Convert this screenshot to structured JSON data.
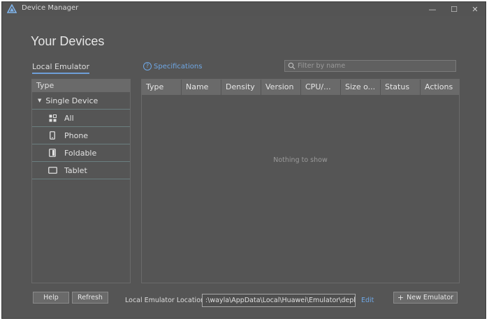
{
  "window": {
    "title": "Device Manager",
    "controls": {
      "minimize": "—",
      "maximize": "☐",
      "close": "✕"
    }
  },
  "header": {
    "title": "Your Devices"
  },
  "tabs": {
    "local_emulator": "Local Emulator"
  },
  "specifications": {
    "label": "Specifications",
    "icon": "help-circle-icon"
  },
  "search": {
    "placeholder": "Filter by name",
    "value": ""
  },
  "device_types": {
    "header": "Type",
    "group": "Single Device",
    "items": [
      {
        "label": "All",
        "icon": "grid-icon"
      },
      {
        "label": "Phone",
        "icon": "phone-icon"
      },
      {
        "label": "Foldable",
        "icon": "foldable-icon"
      },
      {
        "label": "Tablet",
        "icon": "tablet-icon"
      }
    ]
  },
  "table": {
    "columns": [
      "Type",
      "Name",
      "Density",
      "Version",
      "CPU/...",
      "Size o...",
      "Status",
      "Actions"
    ],
    "empty_message": "Nothing to show"
  },
  "footer": {
    "help_label": "Help",
    "refresh_label": "Refresh",
    "location_label": "Local Emulator Location:",
    "location_value": ":\\wayla\\AppData\\Local\\Huawei\\Emulator\\deployed",
    "edit_label": "Edit",
    "new_emulator_label": "New Emulator"
  },
  "colors": {
    "background": "#555555",
    "accent": "#6fa8e6",
    "header_row": "#6a6a6a"
  }
}
